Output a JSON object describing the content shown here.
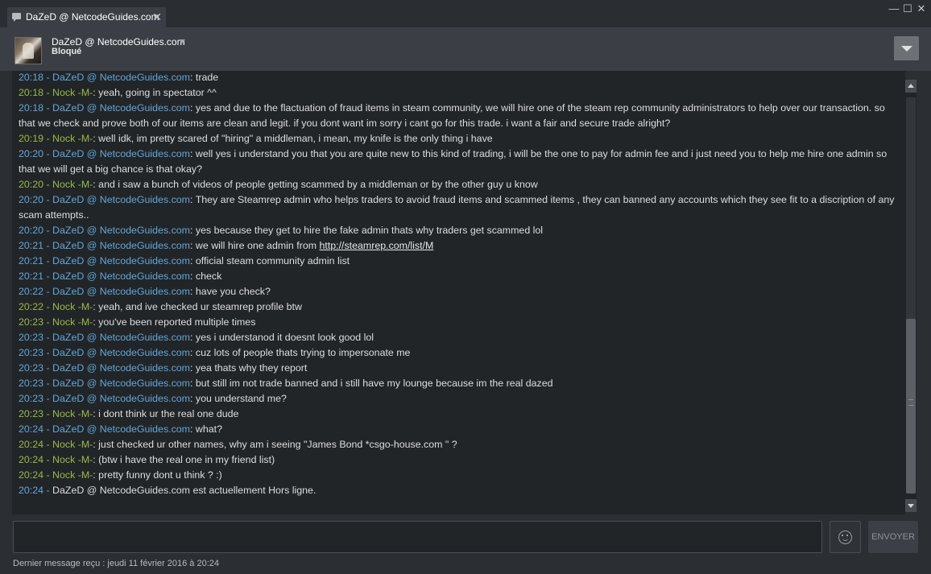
{
  "window": {
    "tab_title": "DaZeD @ NetcodeGuides.com",
    "tab_close": "✕",
    "minimize": "—",
    "maximize": "☐",
    "close": "✕"
  },
  "header": {
    "contact_name": "DaZeD @ NetcodeGuides.com",
    "contact_status": "Bloqué"
  },
  "colors": {
    "dazed": "#62a6d8",
    "nock": "#98b94a",
    "background": "#2b2e32",
    "log_background": "#222528"
  },
  "messages": [
    {
      "time": "20:18",
      "sender": "DaZeD @ NetcodeGuides.com",
      "who": "daz",
      "text": "trade"
    },
    {
      "time": "20:18",
      "sender": "Nock -M-",
      "who": "nock",
      "text": "yeah, going in spectator ^^"
    },
    {
      "time": "20:18",
      "sender": "DaZeD @ NetcodeGuides.com",
      "who": "daz",
      "text": "yes and due to the flactuation of fraud items in steam community, we will hire one of the steam rep community administrators to help over our transaction. so that we check and prove both of our items are clean and legit. if you dont want im sorry i cant go for this trade. i want a fair and secure trade alright?"
    },
    {
      "time": "20:19",
      "sender": "Nock -M-",
      "who": "nock",
      "text": "well idk, im pretty scared of \"hiring\" a middleman, i mean, my knife is the only thing i have"
    },
    {
      "time": "20:20",
      "sender": "DaZeD @ NetcodeGuides.com",
      "who": "daz",
      "text": "well yes i understand you that you are quite new to this kind of trading, i will be the one to pay for admin fee and i just need you to help me hire one admin so that we will get a big chance is that okay?"
    },
    {
      "time": "20:20",
      "sender": "Nock -M-",
      "who": "nock",
      "text": "and i saw a bunch of videos of people getting scammed by a middleman or by the other guy u know"
    },
    {
      "time": "20:20",
      "sender": "DaZeD @ NetcodeGuides.com",
      "who": "daz",
      "text": "They are Steamrep admin who helps traders to avoid fraud items and scammed items , they can banned any accounts which they see fit to a discription of any scam attempts.."
    },
    {
      "time": "20:20",
      "sender": "DaZeD @ NetcodeGuides.com",
      "who": "daz",
      "text": "yes because they get to hire the fake admin thats why traders get scammed lol"
    },
    {
      "time": "20:21",
      "sender": "DaZeD @ NetcodeGuides.com",
      "who": "daz",
      "text": "we will hire one admin from ",
      "link": "http://steamrep.com/list/M"
    },
    {
      "time": "20:21",
      "sender": "DaZeD @ NetcodeGuides.com",
      "who": "daz",
      "text": "official steam community admin list"
    },
    {
      "time": "20:21",
      "sender": "DaZeD @ NetcodeGuides.com",
      "who": "daz",
      "text": "check"
    },
    {
      "time": "20:22",
      "sender": "DaZeD @ NetcodeGuides.com",
      "who": "daz",
      "text": "have you check?"
    },
    {
      "time": "20:22",
      "sender": "Nock -M-",
      "who": "nock",
      "text": "yeah, and ive checked ur steamrep profile btw"
    },
    {
      "time": "20:23",
      "sender": "Nock -M-",
      "who": "nock",
      "text": "you've been reported multiple times"
    },
    {
      "time": "20:23",
      "sender": "DaZeD @ NetcodeGuides.com",
      "who": "daz",
      "text": "yes i understanod it doesnt look good lol"
    },
    {
      "time": "20:23",
      "sender": "DaZeD @ NetcodeGuides.com",
      "who": "daz",
      "text": "cuz lots of people thats trying to impersonate me"
    },
    {
      "time": "20:23",
      "sender": "DaZeD @ NetcodeGuides.com",
      "who": "daz",
      "text": "yea thats why they report"
    },
    {
      "time": "20:23",
      "sender": "DaZeD @ NetcodeGuides.com",
      "who": "daz",
      "text": "but still im not trade banned and i still have my lounge because im the real dazed"
    },
    {
      "time": "20:23",
      "sender": "DaZeD @ NetcodeGuides.com",
      "who": "daz",
      "text": "you understand me?"
    },
    {
      "time": "20:23",
      "sender": "Nock -M-",
      "who": "nock",
      "text": "i dont think ur the real one dude"
    },
    {
      "time": "20:24",
      "sender": "DaZeD @ NetcodeGuides.com",
      "who": "daz",
      "text": "what?"
    },
    {
      "time": "20:24",
      "sender": "Nock -M-",
      "who": "nock",
      "text": "just checked ur other names, why am i seeing \"James Bond *csgo-house.com \" ?"
    },
    {
      "time": "20:24",
      "sender": "Nock -M-",
      "who": "nock",
      "text": "(btw i have the real one in my friend list)"
    },
    {
      "time": "20:24",
      "sender": "Nock -M-",
      "who": "nock",
      "text": "pretty funny dont u think ? :)"
    }
  ],
  "system_message": {
    "time": "20:24",
    "text": "DaZeD @ NetcodeGuides.com est actuellement Hors ligne."
  },
  "composer": {
    "input_value": "",
    "emoji_icon": "smiley-icon",
    "send_label": "ENVOYER"
  },
  "footer": {
    "status": "Dernier message reçu : jeudi 11 février 2016 à 20:24"
  },
  "scroll": {
    "position_fraction": 1.0
  }
}
